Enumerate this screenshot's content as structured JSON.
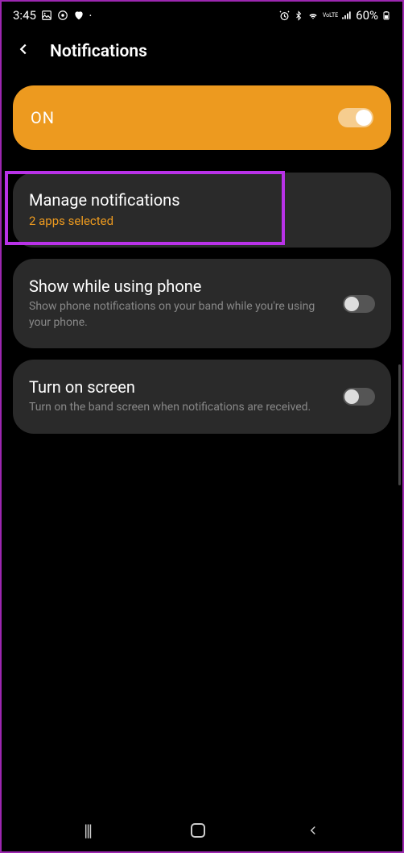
{
  "statusBar": {
    "time": "3:45",
    "batteryPercent": "60%"
  },
  "header": {
    "title": "Notifications"
  },
  "masterToggle": {
    "label": "ON",
    "enabled": true
  },
  "settings": [
    {
      "title": "Manage notifications",
      "subtitle": "2 apps selected",
      "highlighted": true,
      "hasToggle": false
    },
    {
      "title": "Show while using phone",
      "subtitle": "Show phone notifications on your band while you're using your phone.",
      "hasToggle": true,
      "toggleEnabled": false
    },
    {
      "title": "Turn on screen",
      "subtitle": "Turn on the band screen when notifications are received.",
      "hasToggle": true,
      "toggleEnabled": false
    }
  ]
}
